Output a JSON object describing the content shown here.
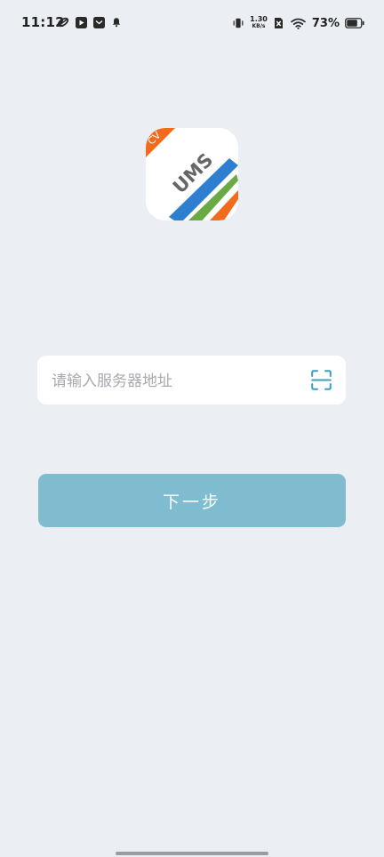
{
  "status_bar": {
    "time": "11:12",
    "net_speed_value": "1.30",
    "net_speed_unit": "KB/s",
    "battery_percent": "73%",
    "icons": [
      "link-icon",
      "video-app-icon",
      "mail-app-icon",
      "bell-icon",
      "vibrate-icon",
      "no-sim-icon",
      "wifi-icon",
      "battery-icon"
    ]
  },
  "logo": {
    "badge_text": "CV",
    "brand_text": "UMS",
    "colors": {
      "orange": "#f26b1d",
      "blue": "#2f7fd1",
      "green": "#6aa944",
      "text_gray": "#666666"
    }
  },
  "server_input": {
    "placeholder": "请输入服务器地址",
    "value": "",
    "scan_icon": "scan-qr-icon"
  },
  "next_button": {
    "label": "下一步",
    "color": "#7fbcd0"
  },
  "theme": {
    "background": "#ebeef3"
  }
}
